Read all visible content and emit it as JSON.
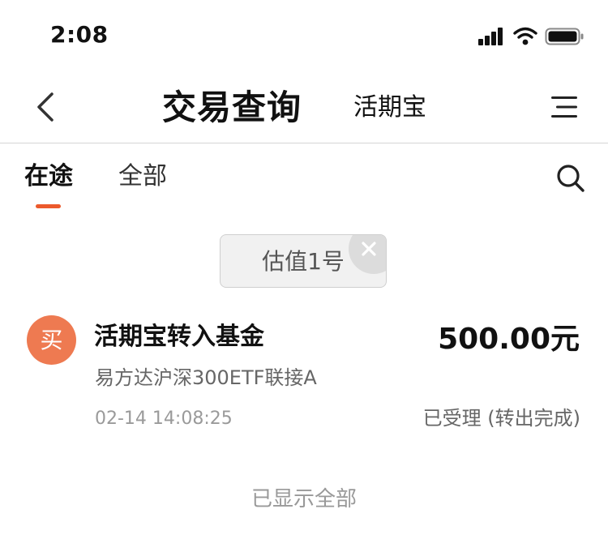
{
  "status_bar": {
    "time": "2:08",
    "icons": [
      "signal-icon",
      "wifi-icon",
      "battery-icon"
    ]
  },
  "nav": {
    "back_icon": "chevron-left-icon",
    "title": "交易查询",
    "subtitle": "活期宝",
    "menu_icon": "hamburger-menu-icon"
  },
  "tabs": [
    {
      "label": "在途",
      "active": true
    },
    {
      "label": "全部",
      "active": false
    }
  ],
  "search_icon": "search-icon",
  "filter_chip": {
    "label": "估值1号",
    "close_icon": "close-icon"
  },
  "transactions": [
    {
      "badge": "买",
      "title": "活期宝转入基金",
      "amount": "500.00元",
      "fund": "易方达沪深300ETF联接A",
      "time": "02-14 14:08:25",
      "status": "已受理 (转出完成)"
    }
  ],
  "footer": {
    "end_text": "已显示全部"
  },
  "colors": {
    "accent": "#ec5a2c",
    "badge": "#ee7a51",
    "divider": "#d4d4d4",
    "chip_bg": "#f1f1f1"
  }
}
